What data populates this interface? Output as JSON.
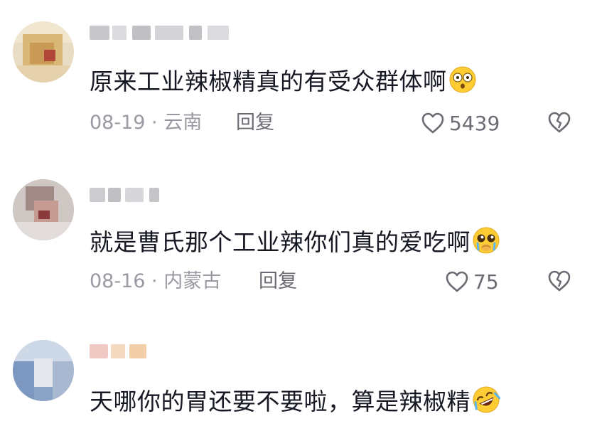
{
  "comments": [
    {
      "text": "原来工业辣椒精真的有受众群体啊",
      "date": "08-19",
      "location": "云南",
      "reply_label": "回复",
      "likes": "5439",
      "emoji_icon": "flushed-face-icon"
    },
    {
      "text": "就是曹氏那个工业辣你们真的爱吃啊",
      "date": "08-16",
      "location": "内蒙古",
      "reply_label": "回复",
      "likes": "75",
      "emoji_icon": "pleading-face-icon"
    },
    {
      "text": "天哪你的胃还要不要啦，算是辣椒精",
      "emoji_icon": "rolling-laughing-face-icon"
    }
  ],
  "meta_separator": " · ",
  "colors": {
    "text": "#161823",
    "meta": "#9a9ba2",
    "action": "#6b6c73"
  }
}
